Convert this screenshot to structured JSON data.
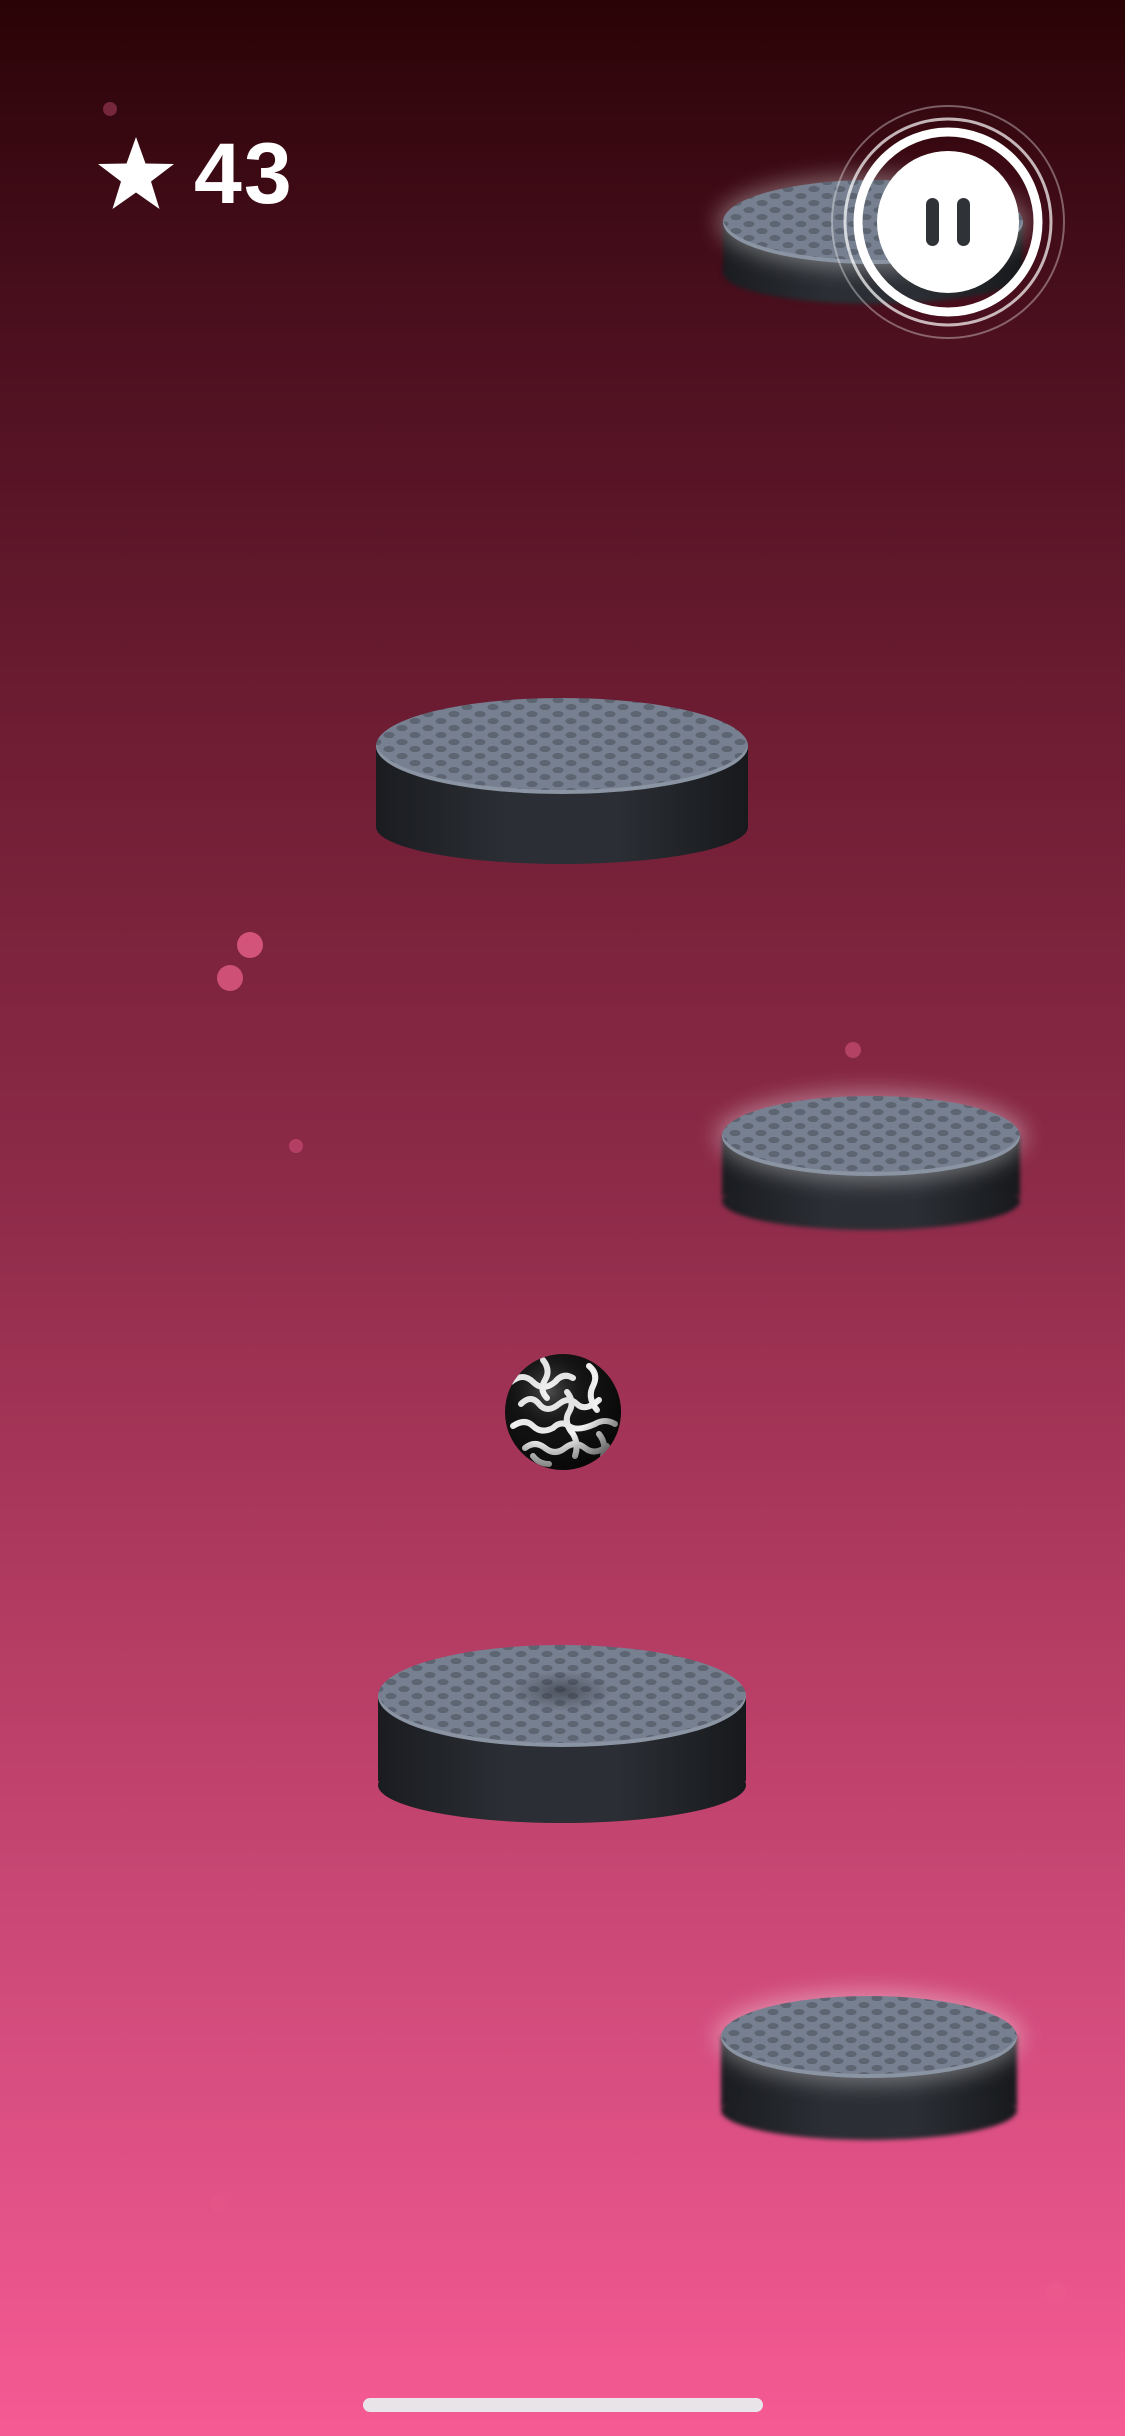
{
  "hud": {
    "score_icon": "star-icon",
    "score": "43",
    "pause_icon": "pause-icon"
  },
  "scene": {
    "ball_pattern": "black-white-maze-sphere",
    "platform_count": 5,
    "colors": {
      "background_top": "#2a0306",
      "background_bottom": "#f65a93",
      "platform_top": "#778090",
      "platform_side": "#2b2e34",
      "particle": "#f06490"
    }
  }
}
